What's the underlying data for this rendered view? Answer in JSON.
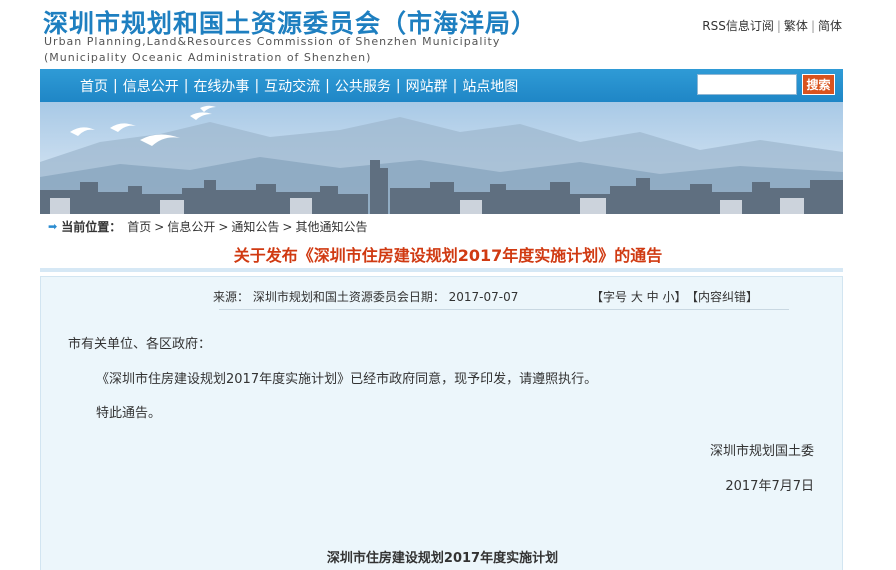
{
  "header": {
    "title_cn": "深圳市规划和国土资源委员会（市海洋局）",
    "title_en_line1": "Urban Planning,Land&Resources Commission of Shenzhen Municipality",
    "title_en_line2": "(Municipality Oceanic Administration of Shenzhen)",
    "links": {
      "rss": "RSS信息订阅",
      "traditional": "繁体",
      "simplified": "简体",
      "separator": "|"
    }
  },
  "nav": {
    "items": [
      "首页",
      "信息公开",
      "在线办事",
      "互动交流",
      "公共服务",
      "网站群",
      "站点地图"
    ],
    "separator": "|",
    "search_placeholder": "",
    "search_button": "搜索"
  },
  "breadcrumb": {
    "label": "当前位置：",
    "items": [
      "首页",
      "信息公开",
      "通知公告",
      "其他通知公告"
    ],
    "separator": ">"
  },
  "article": {
    "title": "关于发布《深圳市住房建设规划2017年度实施计划》的通告",
    "source": "来源：  深圳市规划和国土资源委员会日期： 2017-07-07",
    "font_size_control": "【字号 大 中 小】",
    "correction": "【内容纠错】",
    "addressee": "市有关单位、各区政府：",
    "main_paragraph": "《深圳市住房建设规划2017年度实施计划》已经市政府同意，现予印发，请遵照执行。",
    "notice": "特此通告。",
    "signature": "深圳市规划国土委",
    "date": "2017年7月7日",
    "subtitle": "深圳市住房建设规划2017年度实施计划"
  },
  "colors": {
    "title_blue": "#1e7fc0",
    "nav_blue": "#2f9bd6",
    "article_title_red": "#d03a12",
    "search_button_orange": "#d9531e",
    "content_bg": "#ecf6fb"
  }
}
